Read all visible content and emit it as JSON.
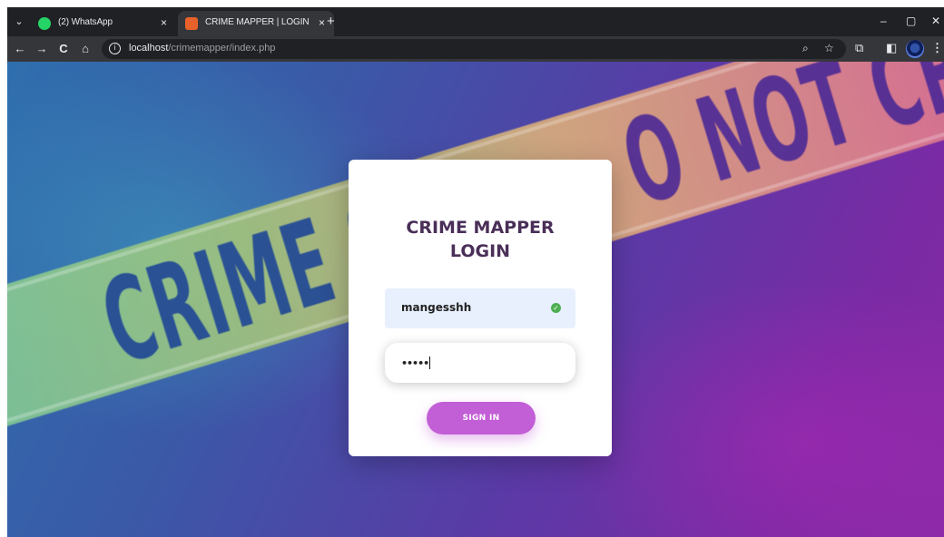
{
  "browser": {
    "tabs": [
      {
        "title": "(2) WhatsApp",
        "close": "×",
        "icon": "whatsapp-icon"
      },
      {
        "title": "CRIME MAPPER | LOGIN",
        "close": "×",
        "icon": "site-favicon"
      }
    ],
    "new_tab": "+",
    "tab_menu": "⌄",
    "window_controls": {
      "minimize": "–",
      "restore": "▢",
      "close": "✕"
    },
    "nav": {
      "back": "←",
      "forward": "→",
      "reload": "C",
      "home": "⌂"
    },
    "url_host": "localhost",
    "url_path": "/crimemapper/index.php",
    "toolbar_icons": {
      "zoom": "⌕",
      "bookmark": "☆",
      "extensions": "⧉",
      "sidepanel": "◧",
      "menu": "⋮"
    }
  },
  "background": {
    "tape_left_text": "CRIME S",
    "tape_right_text": "O NOT CROSS"
  },
  "login": {
    "title": "CRIME MAPPER LOGIN",
    "username_value": "mangesshh",
    "password_value": "•••••",
    "submit_label": "SIGN IN"
  },
  "colors": {
    "card_title": "#4a2f58",
    "button": "#c25ed6",
    "autofill": "#e8f0fe",
    "check": "#4caf50"
  }
}
